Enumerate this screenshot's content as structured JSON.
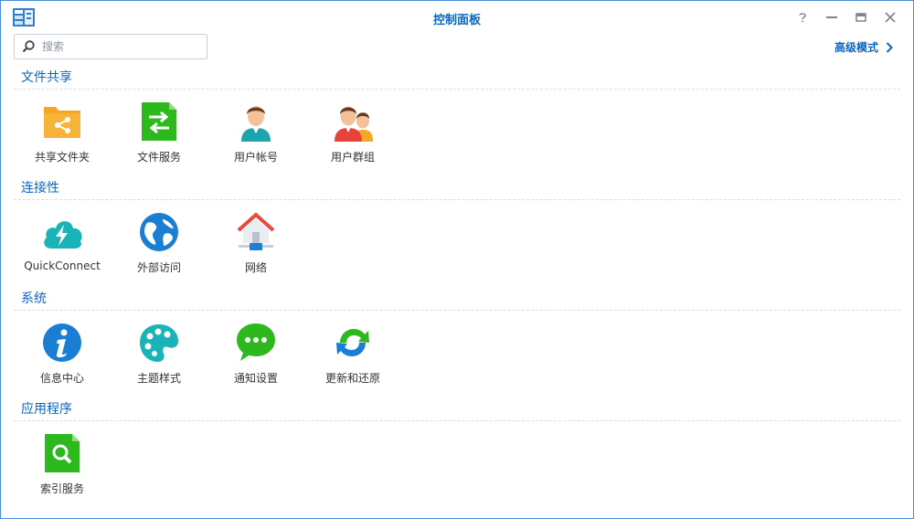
{
  "window": {
    "title": "控制面板"
  },
  "search": {
    "placeholder": "搜索"
  },
  "header": {
    "advanced_label": "高级模式"
  },
  "sections": [
    {
      "title": "文件共享",
      "items": [
        {
          "label": "共享文件夹",
          "icon": "shared-folder-icon"
        },
        {
          "label": "文件服务",
          "icon": "file-services-icon"
        },
        {
          "label": "用户帐号",
          "icon": "user-icon"
        },
        {
          "label": "用户群组",
          "icon": "group-icon"
        }
      ]
    },
    {
      "title": "连接性",
      "items": [
        {
          "label": "QuickConnect",
          "icon": "quickconnect-icon"
        },
        {
          "label": "外部访问",
          "icon": "external-access-icon"
        },
        {
          "label": "网络",
          "icon": "network-icon"
        }
      ]
    },
    {
      "title": "系统",
      "items": [
        {
          "label": "信息中心",
          "icon": "info-center-icon"
        },
        {
          "label": "主题样式",
          "icon": "theme-icon"
        },
        {
          "label": "通知设置",
          "icon": "notification-icon"
        },
        {
          "label": "更新和还原",
          "icon": "update-restore-icon"
        }
      ]
    },
    {
      "title": "应用程序",
      "items": [
        {
          "label": "索引服务",
          "icon": "indexing-service-icon"
        }
      ]
    }
  ],
  "colors": {
    "accent": "#0a66c2",
    "orange": "#f5a623",
    "green": "#2db81d",
    "teal": "#1ab3b8",
    "blue": "#1a7fd4"
  }
}
